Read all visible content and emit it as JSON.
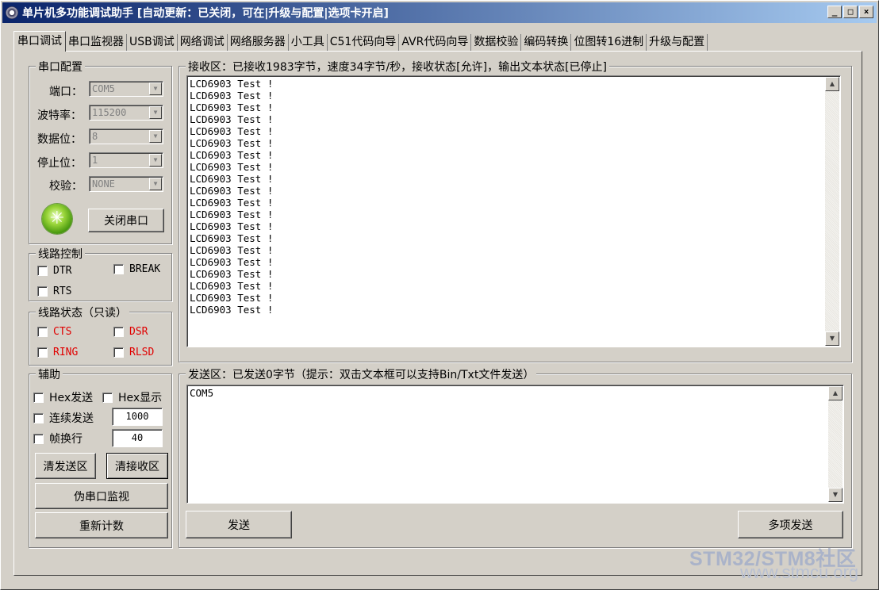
{
  "window": {
    "title": "单片机多功能调试助手 [自动更新：已关闭，可在|升级与配置|选项卡开启]",
    "controls": [
      "_",
      "□",
      "×"
    ]
  },
  "tabs": [
    "串口调试",
    "串口监视器",
    "USB调试",
    "网络调试",
    "网络服务器",
    "小工具",
    "C51代码向导",
    "AVR代码向导",
    "数据校验",
    "编码转换",
    "位图转16进制",
    "升级与配置"
  ],
  "serial_config": {
    "title": "串口配置",
    "port_label": "端口：",
    "port_value": "COM5",
    "baud_label": "波特率：",
    "baud_value": "115200",
    "databits_label": "数据位：",
    "databits_value": "8",
    "stopbits_label": "停止位：",
    "stopbits_value": "1",
    "parity_label": "校验：",
    "parity_value": "NONE",
    "close_button": "关闭串口"
  },
  "line_control": {
    "title": "线路控制",
    "dtr": "DTR",
    "break": "BREAK",
    "rts": "RTS"
  },
  "line_status": {
    "title": "线路状态（只读）",
    "cts": "CTS",
    "dsr": "DSR",
    "ring": "RING",
    "rlsd": "RLSD",
    "status_color": "#e00000"
  },
  "assist": {
    "title": "辅助",
    "hex_send": "Hex发送",
    "hex_display": "Hex显示",
    "continuous_send": "连续发送",
    "continuous_value": "1000",
    "frame_newline": "帧换行",
    "frame_value": "40",
    "clear_send": "清发送区",
    "clear_receive": "清接收区",
    "pseudo_monitor": "伪串口监视",
    "recount": "重新计数"
  },
  "receive": {
    "title": "接收区：已接收1983字节，速度34字节/秒，接收状态[允许]，输出文本状态[已停止]",
    "lines": [
      "LCD6903 Test !",
      "LCD6903 Test !",
      "LCD6903 Test !",
      "LCD6903 Test !",
      "LCD6903 Test !",
      "LCD6903 Test !",
      "LCD6903 Test !",
      "LCD6903 Test !",
      "LCD6903 Test !",
      "LCD6903 Test !",
      "LCD6903 Test !",
      "LCD6903 Test !",
      "LCD6903 Test !",
      "LCD6903 Test !",
      "LCD6903 Test !",
      "LCD6903 Test !",
      "LCD6903 Test !",
      "LCD6903 Test !",
      "LCD6903 Test !",
      "LCD6903 Test !"
    ]
  },
  "send": {
    "title": "发送区：已发送0字节（提示：双击文本框可以支持Bin/Txt文件发送）",
    "content": "COM5",
    "send_button": "发送",
    "multi_send_button": "多项发送"
  },
  "watermark": {
    "line1": "STM32/STM8社区",
    "line2": "www.stmcu.org"
  }
}
